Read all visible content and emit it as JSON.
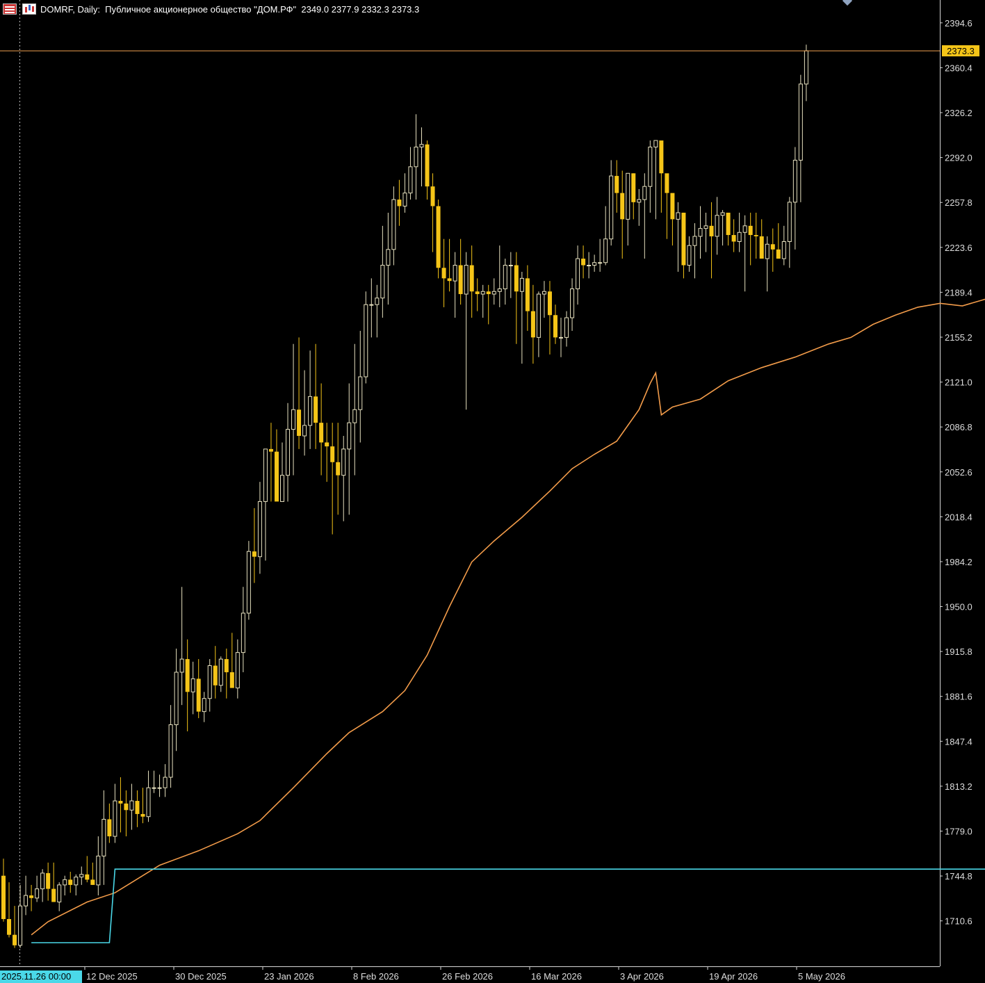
{
  "header": {
    "text": "DOMRF, Daily:  Публичное акционерное общество \"ДОМ.РФ\"  2349.0 2377.9 2332.3 2373.3"
  },
  "colors": {
    "background": "#000000",
    "bull": "#e8e2c0",
    "bear": "#f5c518",
    "ma": "#f39c4a",
    "level": "#4ad8e8",
    "price_line": "#f0a050",
    "axis_text": "#dddddd"
  },
  "chart_data": {
    "type": "candlestick",
    "symbol": "DOMRF",
    "timeframe": "Daily",
    "ylim": [
      1676,
      2412
    ],
    "y_ticks": [
      2394.6,
      2360.4,
      2326.2,
      2292.0,
      2257.8,
      2223.6,
      2189.4,
      2155.2,
      2121.0,
      2086.8,
      2052.6,
      2018.4,
      1984.2,
      1950.0,
      1915.8,
      1881.6,
      1847.4,
      1813.2,
      1779.0,
      1744.8,
      1710.6
    ],
    "x_labels": [
      {
        "label": "2025.11.26 00:00",
        "highlight": true
      },
      {
        "label": "12 Dec 2025"
      },
      {
        "label": "30 Dec 2025"
      },
      {
        "label": "23 Jan 2026"
      },
      {
        "label": "8 Feb 2026"
      },
      {
        "label": "26 Feb 2026"
      },
      {
        "label": "16 Mar 2026"
      },
      {
        "label": "3 Apr 2026"
      },
      {
        "label": "19 Apr 2026"
      },
      {
        "label": "5 May 2026"
      }
    ],
    "ohlc_open": [
      1745,
      1712,
      1700,
      1692,
      1722,
      1730,
      1728,
      1735,
      1747,
      1735,
      1725,
      1738,
      1742,
      1738,
      1744,
      1746,
      1742,
      1738,
      1760,
      1788,
      1775,
      1802,
      1800,
      1795,
      1802,
      1792,
      1790,
      1812,
      1812,
      1812,
      1820,
      1860,
      1900,
      1910,
      1885,
      1895,
      1870,
      1880,
      1905,
      1890,
      1910,
      1900,
      1888,
      1915,
      1945,
      1992,
      1988,
      2030,
      2070,
      2068,
      2030,
      2050,
      2085,
      2100,
      2080,
      2088,
      2110,
      2090,
      2075,
      2072,
      2060,
      2050,
      2070,
      2090,
      2100,
      2125,
      2180,
      2180,
      2185,
      2210,
      2222,
      2260,
      2255,
      2265,
      2285,
      2300,
      2302,
      2270,
      2255,
      2208,
      2200,
      2198,
      2210,
      2188,
      2210,
      2190,
      2188,
      2190,
      2188,
      2190,
      2192,
      2210,
      2210,
      2190,
      2200,
      2175,
      2155,
      2188,
      2190,
      2172,
      2155,
      2155,
      2170,
      2192,
      2215,
      2210,
      2210,
      2212,
      2212,
      2230,
      2278,
      2265,
      2245,
      2280,
      2258,
      2260,
      2270,
      2300,
      2305,
      2280,
      2265,
      2245,
      2250,
      2210,
      2225,
      2232,
      2238,
      2240,
      2232,
      2248,
      2250,
      2233,
      2228,
      2235,
      2240,
      2233,
      2232,
      2215,
      2226,
      2222,
      2215,
      2228,
      2258,
      2290,
      2348
    ],
    "ohlc_high": [
      1758,
      1740,
      1722,
      1738,
      1745,
      1738,
      1745,
      1750,
      1755,
      1755,
      1740,
      1745,
      1748,
      1746,
      1752,
      1760,
      1755,
      1775,
      1810,
      1800,
      1815,
      1820,
      1810,
      1815,
      1810,
      1812,
      1825,
      1825,
      1822,
      1830,
      1875,
      1918,
      1965,
      1925,
      1908,
      1910,
      1885,
      1910,
      1920,
      1912,
      1918,
      1930,
      1925,
      1965,
      2000,
      2025,
      2045,
      2070,
      2090,
      2085,
      2075,
      2105,
      2150,
      2155,
      2130,
      2145,
      2150,
      2120,
      2090,
      2090,
      2090,
      2080,
      2120,
      2150,
      2160,
      2190,
      2200,
      2195,
      2240,
      2250,
      2270,
      2275,
      2280,
      2300,
      2325,
      2315,
      2305,
      2280,
      2260,
      2230,
      2230,
      2220,
      2230,
      2220,
      2225,
      2200,
      2195,
      2195,
      2200,
      2225,
      2215,
      2220,
      2220,
      2205,
      2210,
      2195,
      2190,
      2198,
      2198,
      2180,
      2170,
      2175,
      2200,
      2225,
      2225,
      2220,
      2218,
      2230,
      2255,
      2290,
      2290,
      2282,
      2275,
      2280,
      2268,
      2280,
      2305,
      2305,
      2285,
      2270,
      2252,
      2258,
      2250,
      2232,
      2242,
      2255,
      2250,
      2258,
      2262,
      2252,
      2248,
      2245,
      2250,
      2248,
      2250,
      2250,
      2245,
      2232,
      2238,
      2242,
      2240,
      2262,
      2300,
      2355,
      2378
    ],
    "ohlc_low": [
      1710,
      1698,
      1690,
      1690,
      1715,
      1718,
      1725,
      1725,
      1726,
      1725,
      1718,
      1730,
      1732,
      1730,
      1738,
      1740,
      1738,
      1730,
      1738,
      1770,
      1770,
      1778,
      1775,
      1780,
      1782,
      1785,
      1786,
      1808,
      1805,
      1805,
      1812,
      1840,
      1875,
      1855,
      1868,
      1865,
      1862,
      1870,
      1880,
      1885,
      1880,
      1892,
      1880,
      1900,
      1940,
      1968,
      1975,
      1985,
      2030,
      2050,
      2030,
      2030,
      2050,
      2070,
      2065,
      2070,
      2070,
      2050,
      2045,
      2005,
      2020,
      2015,
      2020,
      2050,
      2075,
      2120,
      2155,
      2155,
      2170,
      2180,
      2210,
      2240,
      2250,
      2260,
      2260,
      2270,
      2260,
      2220,
      2200,
      2178,
      2190,
      2170,
      2180,
      2100,
      2170,
      2175,
      2170,
      2165,
      2180,
      2178,
      2180,
      2185,
      2150,
      2135,
      2160,
      2135,
      2140,
      2170,
      2142,
      2150,
      2140,
      2148,
      2160,
      2180,
      2200,
      2200,
      2205,
      2205,
      2210,
      2225,
      2250,
      2215,
      2225,
      2245,
      2240,
      2215,
      2250,
      2245,
      2250,
      2230,
      2225,
      2205,
      2200,
      2205,
      2200,
      2215,
      2220,
      2200,
      2218,
      2225,
      2225,
      2220,
      2220,
      2190,
      2210,
      2215,
      2215,
      2190,
      2205,
      2215,
      2210,
      2208,
      2222,
      2258,
      2335
    ],
    "ohlc_close": [
      1712,
      1700,
      1692,
      1722,
      1730,
      1728,
      1735,
      1747,
      1735,
      1725,
      1738,
      1742,
      1738,
      1744,
      1746,
      1742,
      1738,
      1760,
      1788,
      1775,
      1802,
      1800,
      1795,
      1802,
      1792,
      1790,
      1812,
      1812,
      1812,
      1820,
      1860,
      1900,
      1910,
      1885,
      1895,
      1870,
      1880,
      1905,
      1890,
      1910,
      1900,
      1888,
      1915,
      1945,
      1992,
      1988,
      2030,
      2070,
      2068,
      2030,
      2050,
      2085,
      2100,
      2080,
      2088,
      2110,
      2090,
      2075,
      2072,
      2060,
      2050,
      2070,
      2090,
      2100,
      2125,
      2180,
      2180,
      2185,
      2210,
      2222,
      2260,
      2255,
      2265,
      2285,
      2300,
      2302,
      2270,
      2255,
      2208,
      2200,
      2198,
      2210,
      2188,
      2210,
      2190,
      2188,
      2190,
      2188,
      2190,
      2192,
      2210,
      2210,
      2190,
      2200,
      2175,
      2155,
      2188,
      2190,
      2172,
      2155,
      2155,
      2170,
      2192,
      2215,
      2210,
      2210,
      2212,
      2212,
      2230,
      2278,
      2265,
      2245,
      2280,
      2258,
      2260,
      2270,
      2300,
      2305,
      2280,
      2265,
      2245,
      2250,
      2210,
      2225,
      2232,
      2238,
      2240,
      2232,
      2248,
      2250,
      2233,
      2228,
      2235,
      2240,
      2233,
      2232,
      2215,
      2226,
      2222,
      2215,
      2228,
      2258,
      2290,
      2348,
      2373.3
    ],
    "ma_line": {
      "label": "2201.4",
      "points": [
        [
          5,
          1700
        ],
        [
          8,
          1710
        ],
        [
          15,
          1725
        ],
        [
          20,
          1732
        ],
        [
          28,
          1753
        ],
        [
          35,
          1764
        ],
        [
          42,
          1777
        ],
        [
          46,
          1787
        ],
        [
          52,
          1812
        ],
        [
          58,
          1838
        ],
        [
          62,
          1854
        ],
        [
          68,
          1870
        ],
        [
          72,
          1886
        ],
        [
          76,
          1913
        ],
        [
          80,
          1950
        ],
        [
          84,
          1984
        ],
        [
          88,
          2000
        ],
        [
          93,
          2018
        ],
        [
          98,
          2038
        ],
        [
          102,
          2055
        ],
        [
          106,
          2066
        ],
        [
          110,
          2076
        ],
        [
          114,
          2100
        ],
        [
          116,
          2120
        ],
        [
          117,
          2128
        ],
        [
          118,
          2096
        ],
        [
          120,
          2102
        ],
        [
          125,
          2108
        ],
        [
          130,
          2122
        ],
        [
          136,
          2132
        ],
        [
          142,
          2140
        ],
        [
          148,
          2150
        ],
        [
          152,
          2155
        ],
        [
          156,
          2165
        ],
        [
          160,
          2172
        ],
        [
          164,
          2178
        ],
        [
          168,
          2181
        ],
        [
          170,
          2180
        ],
        [
          172,
          2179
        ],
        [
          176,
          2184
        ],
        [
          180,
          2188
        ],
        [
          185,
          2192
        ],
        [
          188,
          2198
        ],
        [
          190,
          2201.4
        ]
      ]
    },
    "level_line": {
      "label": "1750.0",
      "points": [
        [
          5,
          1694
        ],
        [
          19,
          1694
        ],
        [
          20,
          1750
        ],
        [
          190,
          1750
        ]
      ]
    },
    "current_price": 2373.3
  }
}
